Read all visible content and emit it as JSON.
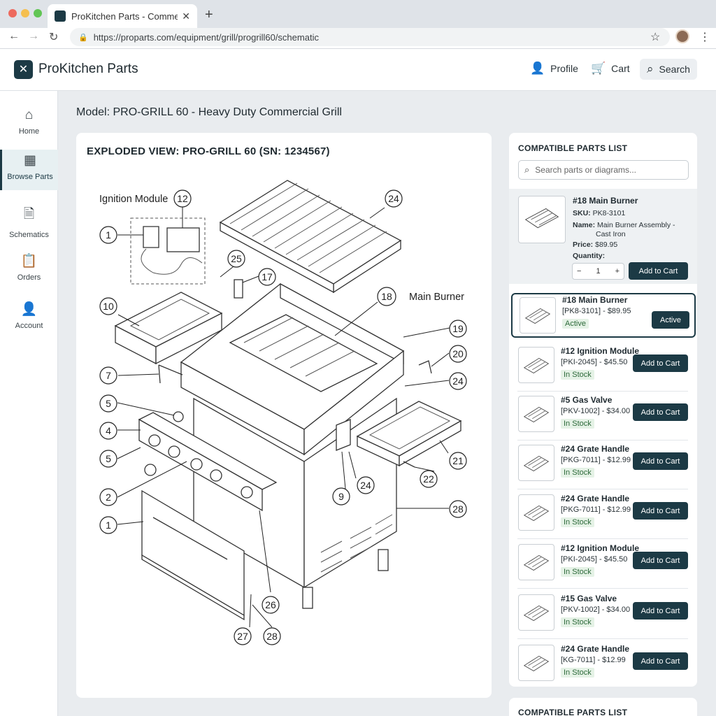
{
  "browser": {
    "tab_title": "ProKitchen Parts - Commercial",
    "url": "https://proparts.com/equipment/grill/progrill60/schematic"
  },
  "header": {
    "brand": "ProKitchen Parts",
    "profile_label": "Profile",
    "cart_label": "Cart",
    "search_label": "Search"
  },
  "sidebar": {
    "items": [
      {
        "label": "Home",
        "icon": "home-icon"
      },
      {
        "label": "Browse Parts",
        "icon": "grid-icon",
        "active": true
      },
      {
        "label": "Schematics",
        "icon": "schematic-icon"
      },
      {
        "label": "Orders",
        "icon": "clipboard-icon"
      },
      {
        "label": "Account",
        "icon": "user-icon"
      }
    ]
  },
  "main": {
    "page_title": "Model: PRO-GRILL 60 - Heavy Duty Commercial Grill",
    "diagram": {
      "title": "EXPLODED VIEW: PRO-GRILL 60 (SN: 1234567)",
      "label_ignition": "Ignition Module",
      "label_burner": "Main Burner",
      "callouts": [
        "12",
        "24",
        "1",
        "25",
        "17",
        "10",
        "18",
        "19",
        "20",
        "7",
        "24",
        "5",
        "4",
        "5",
        "2",
        "1",
        "24",
        "9",
        "22",
        "21",
        "28",
        "26",
        "27",
        "28"
      ]
    }
  },
  "parts_panel": {
    "title": "COMPATIBLE PARTS LIST",
    "search_placeholder": "Search parts or diagrams...",
    "detail": {
      "title": "#18 Main Burner",
      "sku_label": "SKU:",
      "sku": "PK8-3101",
      "name_label": "Name:",
      "name_line1": "Main Burner Assembly -",
      "name_line2": "Cast Iron",
      "price_label": "Price:",
      "price": "$89.95",
      "quantity_label": "Quantity:",
      "quantity": "1",
      "add_label": "Add to Cart"
    },
    "rows": [
      {
        "title": "#18 Main Burner",
        "sub": "[PK8-3101] - $89.95",
        "status": "Active",
        "button": "Active",
        "active": true
      },
      {
        "title": "#12 Ignition Module",
        "sub": "[PKI-2045] - $45.50",
        "status": "In Stock",
        "button": "Add to Cart"
      },
      {
        "title": "#5 Gas Valve",
        "sub": "[PKV-1002] - $34.00",
        "status": "In Stock",
        "button": "Add to Cart"
      },
      {
        "title": "#24 Grate Handle",
        "sub": "[PKG-7011] - $12.99",
        "status": "In Stock",
        "button": "Add to Cart"
      },
      {
        "title": "#24 Grate Handle",
        "sub": "[PKG-7011] - $12.99",
        "status": "In Stock",
        "button": "Add to Cart"
      },
      {
        "title": "#12 Ignition Module",
        "sub": "[PKI-2045] - $45.50",
        "status": "In Stock",
        "button": "Add to Cart"
      },
      {
        "title": "#15 Gas Valve",
        "sub": "[PKV-1002] - $34.00",
        "status": "In Stock",
        "button": "Add to Cart"
      },
      {
        "title": "#24 Grate Handle",
        "sub": "[KG-7011] - $12.99",
        "status": "In Stock",
        "button": "Add to Cart"
      }
    ],
    "second_title": "COMPATIBLE PARTS LIST"
  },
  "colors": {
    "accent": "#1c3a45",
    "stock_bg": "#e5f2e6",
    "stock_text": "#2d6a3a"
  }
}
